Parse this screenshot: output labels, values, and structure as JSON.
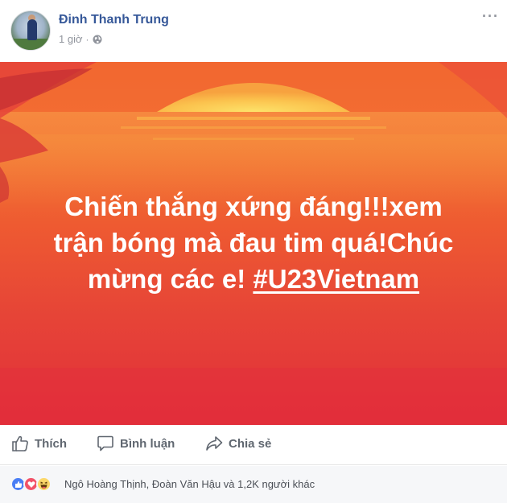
{
  "post": {
    "author": "Đinh Thanh Trung",
    "time": "1 giờ",
    "visibility_icon": "globe-icon",
    "more_icon": "more-options-icon",
    "text_lines": [
      "Chiến thắng xứng đáng!!!xem",
      "trận bóng mà đau tim quá!Chúc",
      "mừng các e!"
    ],
    "hashtag": "#U23Vietnam",
    "colors": {
      "author": "#365899",
      "bg_top": "#f06a2e",
      "bg_bottom": "#e22f3a"
    }
  },
  "actions": {
    "like_label": "Thích",
    "comment_label": "Bình luận",
    "share_label": "Chia sẻ"
  },
  "reactions": {
    "icons": [
      "like-icon",
      "love-icon",
      "haha-icon"
    ],
    "summary": "Ngô Hoàng Thịnh, Đoàn Văn Hậu và 1,2K người khác"
  }
}
